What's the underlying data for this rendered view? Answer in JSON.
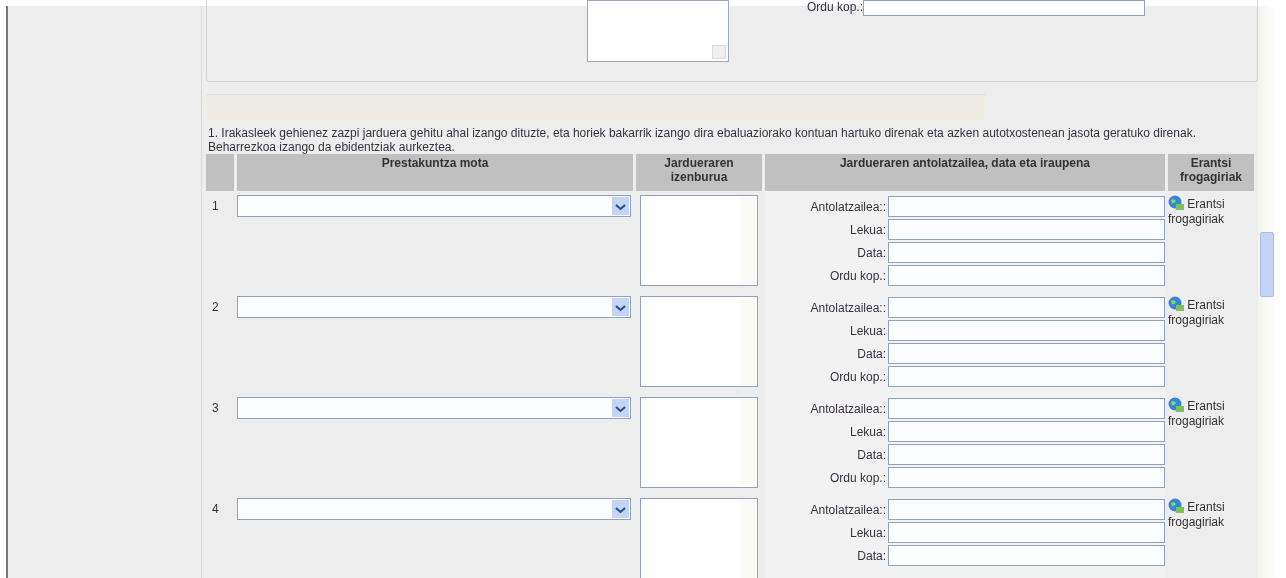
{
  "top_panel": {
    "field_label": "Ordu kop.:"
  },
  "instructions": "1. Irakasleek gehienez zazpi jarduera gehitu ahal izango dituzte, eta horiek bakarrik izango dira ebaluaziorako kontuan hartuko direnak eta azken autotxostenean jasota geratuko direnak. Beharrezkoa izango da ebidentziak aurkeztea.",
  "table": {
    "columns": [
      "Prestakuntza mota",
      "Jardueraren izenburua",
      "Jardueraren antolatzailea, data eta iraupena",
      "Erantsi frogagiriak"
    ],
    "rows": [
      {
        "number": "1",
        "fields": [
          "Antolatzailea::",
          "Lekua:",
          "Data:",
          "Ordu kop.:"
        ],
        "attach_link": "Erantsi frogagiriak"
      },
      {
        "number": "2",
        "fields": [
          "Antolatzailea::",
          "Lekua:",
          "Data:",
          "Ordu kop.:"
        ],
        "attach_link": "Erantsi frogagiriak"
      },
      {
        "number": "3",
        "fields": [
          "Antolatzailea::",
          "Lekua:",
          "Data:",
          "Ordu kop.:"
        ],
        "attach_link": "Erantsi frogagiriak"
      },
      {
        "number": "4",
        "fields": [
          "Antolatzailea::",
          "Lekua:",
          "Data:"
        ],
        "attach_link": "Erantsi frogagiriak"
      }
    ]
  }
}
